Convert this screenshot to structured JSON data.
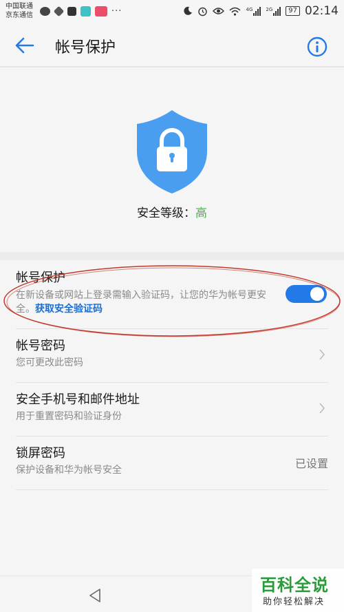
{
  "status_bar": {
    "carrier_line1": "中国联通",
    "carrier_line2": "京东通信",
    "more": "···",
    "net_a": "4G",
    "net_b": "2G",
    "battery": "97",
    "time": "02:14"
  },
  "header": {
    "title": "帐号保护"
  },
  "security": {
    "label": "安全等级：",
    "value": "高",
    "shield_color": "#4a9ef0"
  },
  "list": {
    "protect": {
      "title": "帐号保护",
      "subtitle": "在新设备或网站上登录需输入验证码，让您的华为帐号更安全。",
      "link": "获取安全验证码",
      "enabled": true
    },
    "password": {
      "title": "帐号密码",
      "subtitle": "您可更改此密码"
    },
    "phone_email": {
      "title": "安全手机号和邮件地址",
      "subtitle": "用于重置密码和验证身份"
    },
    "lock_screen": {
      "title": "锁屏密码",
      "subtitle": "保护设备和华为帐号安全",
      "status": "已设置"
    }
  },
  "watermark": {
    "main": "百科全说",
    "sub": "助你轻松解决"
  },
  "colors": {
    "accent": "#2479e8",
    "link": "#1a6fd6",
    "level_high": "#4caf50",
    "annotation": "#c0392b"
  }
}
